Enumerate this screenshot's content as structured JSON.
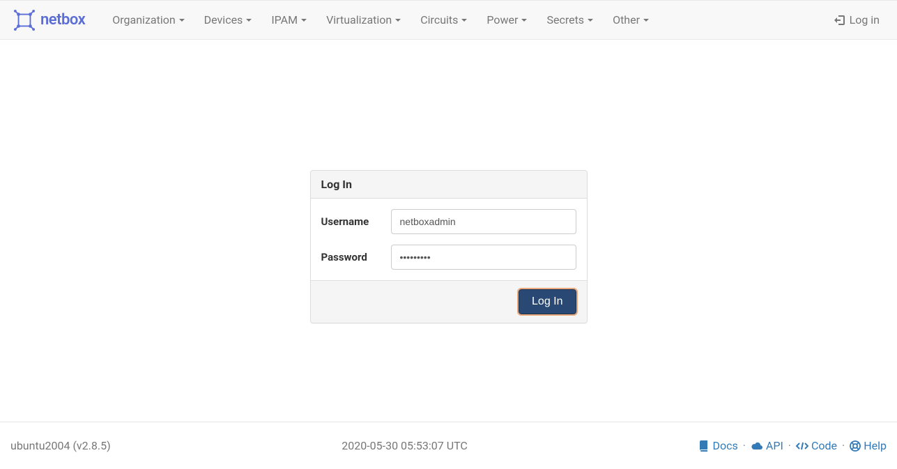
{
  "brand": {
    "name": "netbox"
  },
  "nav": {
    "items": [
      {
        "label": "Organization"
      },
      {
        "label": "Devices"
      },
      {
        "label": "IPAM"
      },
      {
        "label": "Virtualization"
      },
      {
        "label": "Circuits"
      },
      {
        "label": "Power"
      },
      {
        "label": "Secrets"
      },
      {
        "label": "Other"
      }
    ],
    "login_link": "Log in"
  },
  "login": {
    "panel_title": "Log In",
    "username_label": "Username",
    "username_value": "netboxadmin",
    "password_label": "Password",
    "password_value": "•••••••••",
    "submit_label": "Log In"
  },
  "footer": {
    "host_version": "ubuntu2004 (v2.8.5)",
    "timestamp": "2020-05-30 05:53:07 UTC",
    "links": {
      "docs": "Docs",
      "api": "API",
      "code": "Code",
      "help": "Help"
    }
  }
}
